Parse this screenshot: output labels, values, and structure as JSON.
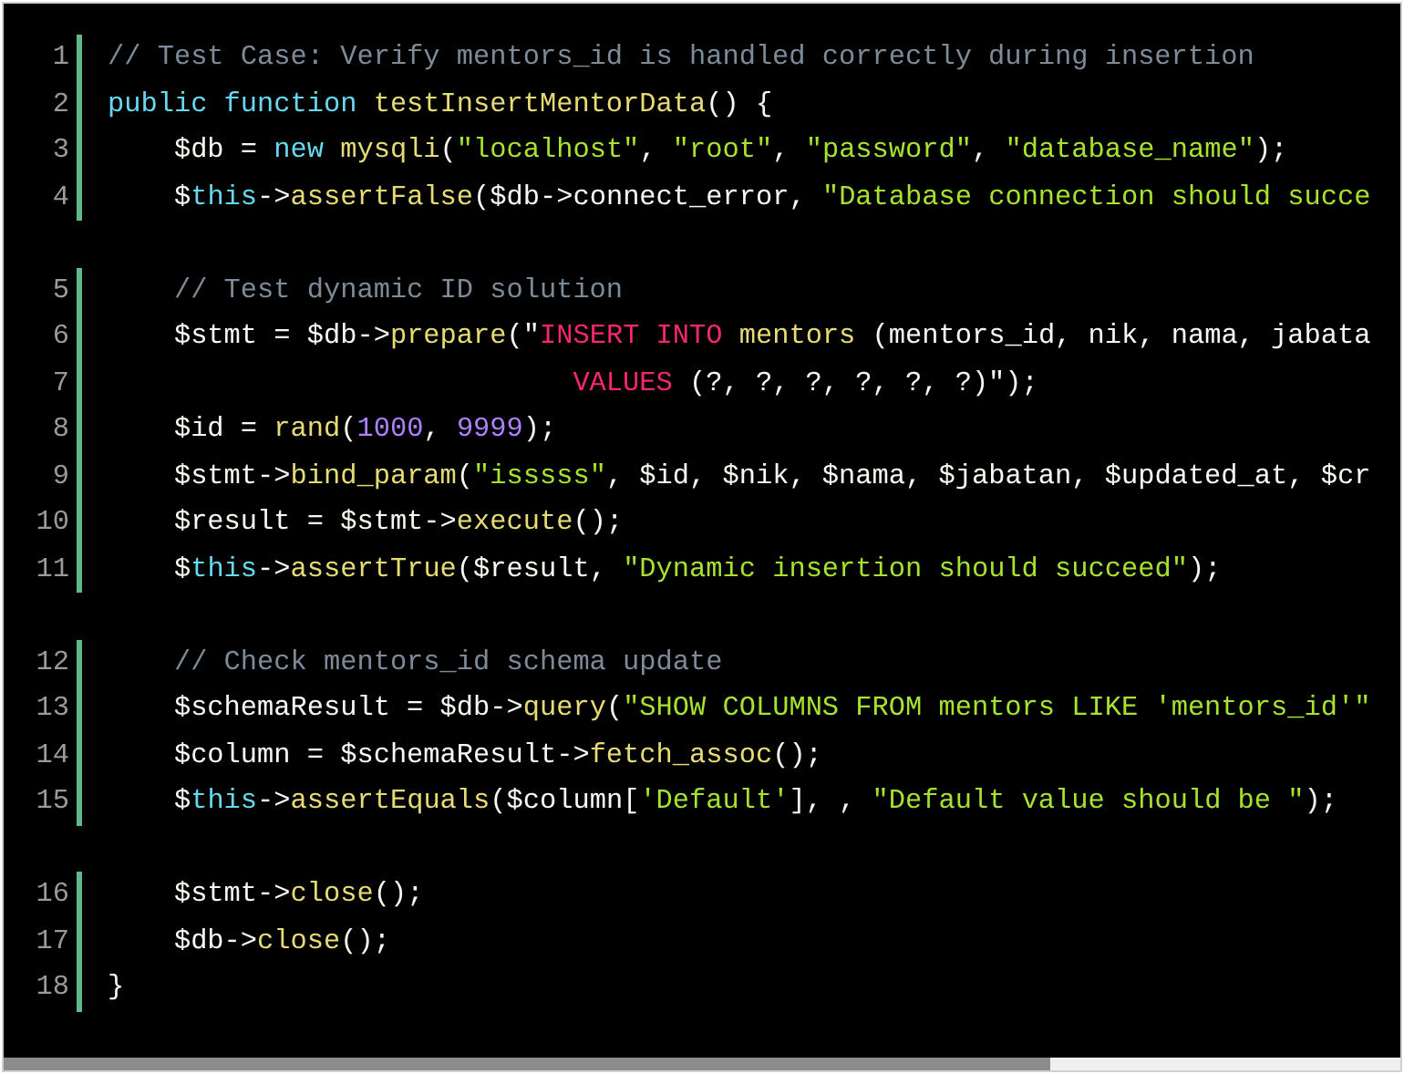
{
  "code_block": {
    "groups": [
      {
        "lines": [
          {
            "number": "1",
            "tokens": [
              {
                "kind": "comment",
                "text": "// Test Case: Verify mentors_id is handled correctly during insertion"
              }
            ]
          },
          {
            "number": "2",
            "tokens": [
              {
                "kind": "keyword",
                "text": "public function "
              },
              {
                "kind": "function",
                "text": "testInsertMentorData"
              },
              {
                "kind": "plain",
                "text": "() {"
              }
            ]
          },
          {
            "number": "3",
            "tokens": [
              {
                "kind": "plain",
                "text": "    $db = "
              },
              {
                "kind": "keyword",
                "text": "new "
              },
              {
                "kind": "function",
                "text": "mysqli"
              },
              {
                "kind": "plain",
                "text": "("
              },
              {
                "kind": "string",
                "text": "\"localhost\""
              },
              {
                "kind": "plain",
                "text": ", "
              },
              {
                "kind": "string",
                "text": "\"root\""
              },
              {
                "kind": "plain",
                "text": ", "
              },
              {
                "kind": "string",
                "text": "\"password\""
              },
              {
                "kind": "plain",
                "text": ", "
              },
              {
                "kind": "string",
                "text": "\"database_name\""
              },
              {
                "kind": "plain",
                "text": ");"
              }
            ]
          },
          {
            "number": "4",
            "tokens": [
              {
                "kind": "plain",
                "text": "    $"
              },
              {
                "kind": "keyword",
                "text": "this"
              },
              {
                "kind": "plain",
                "text": "->"
              },
              {
                "kind": "function",
                "text": "assertFalse"
              },
              {
                "kind": "plain",
                "text": "($db->connect_error, "
              },
              {
                "kind": "string",
                "text": "\"Database connection should succe"
              }
            ]
          }
        ]
      },
      {
        "lines": [
          {
            "number": "5",
            "tokens": [
              {
                "kind": "comment",
                "text": "    // Test dynamic ID solution"
              }
            ]
          },
          {
            "number": "6",
            "tokens": [
              {
                "kind": "plain",
                "text": "    $stmt = $db->"
              },
              {
                "kind": "function",
                "text": "prepare"
              },
              {
                "kind": "plain",
                "text": "(\""
              },
              {
                "kind": "sql",
                "text": "INSERT INTO "
              },
              {
                "kind": "function",
                "text": "mentors"
              },
              {
                "kind": "plain",
                "text": " (mentors_id, nik, nama, jabata"
              }
            ]
          },
          {
            "number": "7",
            "tokens": [
              {
                "kind": "sql",
                "text": "                            VALUES"
              },
              {
                "kind": "plain",
                "text": " (?, ?, ?, ?, ?, ?)\");"
              }
            ]
          },
          {
            "number": "8",
            "tokens": [
              {
                "kind": "plain",
                "text": "    $id = "
              },
              {
                "kind": "function",
                "text": "rand"
              },
              {
                "kind": "plain",
                "text": "("
              },
              {
                "kind": "number",
                "text": "1000"
              },
              {
                "kind": "plain",
                "text": ", "
              },
              {
                "kind": "number",
                "text": "9999"
              },
              {
                "kind": "plain",
                "text": ");"
              }
            ]
          },
          {
            "number": "9",
            "tokens": [
              {
                "kind": "plain",
                "text": "    $stmt->"
              },
              {
                "kind": "function",
                "text": "bind_param"
              },
              {
                "kind": "plain",
                "text": "("
              },
              {
                "kind": "string",
                "text": "\"isssss\""
              },
              {
                "kind": "plain",
                "text": ", $id, $nik, $nama, $jabatan, $updated_at, $cr"
              }
            ]
          },
          {
            "number": "10",
            "tokens": [
              {
                "kind": "plain",
                "text": "    $result = $stmt->"
              },
              {
                "kind": "function",
                "text": "execute"
              },
              {
                "kind": "plain",
                "text": "();"
              }
            ]
          },
          {
            "number": "11",
            "tokens": [
              {
                "kind": "plain",
                "text": "    $"
              },
              {
                "kind": "keyword",
                "text": "this"
              },
              {
                "kind": "plain",
                "text": "->"
              },
              {
                "kind": "function",
                "text": "assertTrue"
              },
              {
                "kind": "plain",
                "text": "($result, "
              },
              {
                "kind": "string",
                "text": "\"Dynamic insertion should succeed\""
              },
              {
                "kind": "plain",
                "text": ");"
              }
            ]
          }
        ]
      },
      {
        "lines": [
          {
            "number": "12",
            "tokens": [
              {
                "kind": "comment",
                "text": "    // Check mentors_id schema update"
              }
            ]
          },
          {
            "number": "13",
            "tokens": [
              {
                "kind": "plain",
                "text": "    $schemaResult = $db->"
              },
              {
                "kind": "function",
                "text": "query"
              },
              {
                "kind": "plain",
                "text": "("
              },
              {
                "kind": "string",
                "text": "\"SHOW COLUMNS FROM mentors LIKE 'mentors_id'\""
              }
            ]
          },
          {
            "number": "14",
            "tokens": [
              {
                "kind": "plain",
                "text": "    $column = $schemaResult->"
              },
              {
                "kind": "function",
                "text": "fetch_assoc"
              },
              {
                "kind": "plain",
                "text": "();"
              }
            ]
          },
          {
            "number": "15",
            "tokens": [
              {
                "kind": "plain",
                "text": "    $"
              },
              {
                "kind": "keyword",
                "text": "this"
              },
              {
                "kind": "plain",
                "text": "->"
              },
              {
                "kind": "function",
                "text": "assertEquals"
              },
              {
                "kind": "plain",
                "text": "($column["
              },
              {
                "kind": "string",
                "text": "'Default'"
              },
              {
                "kind": "plain",
                "text": "], , "
              },
              {
                "kind": "string",
                "text": "\"Default value should be \""
              },
              {
                "kind": "plain",
                "text": ");"
              }
            ]
          }
        ]
      },
      {
        "lines": [
          {
            "number": "16",
            "tokens": [
              {
                "kind": "plain",
                "text": "    $stmt->"
              },
              {
                "kind": "function",
                "text": "close"
              },
              {
                "kind": "plain",
                "text": "();"
              }
            ]
          },
          {
            "number": "17",
            "tokens": [
              {
                "kind": "plain",
                "text": "    $db->"
              },
              {
                "kind": "function",
                "text": "close"
              },
              {
                "kind": "plain",
                "text": "();"
              }
            ]
          },
          {
            "number": "18",
            "tokens": [
              {
                "kind": "plain",
                "text": "}"
              }
            ]
          }
        ]
      }
    ]
  }
}
